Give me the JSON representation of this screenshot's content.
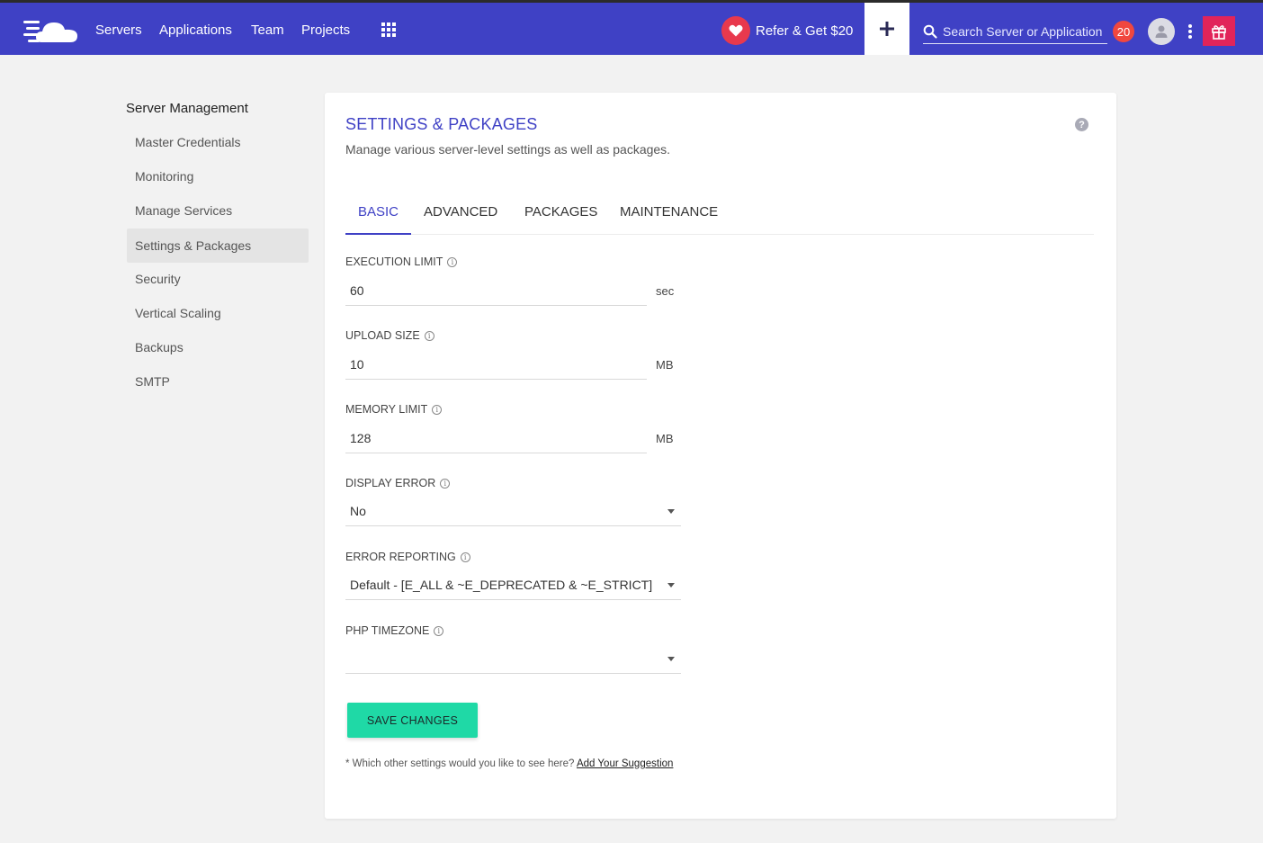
{
  "nav": {
    "links": [
      "Servers",
      "Applications",
      "Team",
      "Projects"
    ],
    "refer_label": "Refer & Get $20",
    "search_placeholder": "Search Server or Application",
    "notification_count": "20"
  },
  "sidebar": {
    "title": "Server Management",
    "items": [
      "Master Credentials",
      "Monitoring",
      "Manage Services",
      "Settings & Packages",
      "Security",
      "Vertical Scaling",
      "Backups",
      "SMTP"
    ],
    "active_item": "Settings & Packages"
  },
  "card": {
    "title": "SETTINGS & PACKAGES",
    "subtitle": "Manage various server-level settings as well as packages.",
    "help_glyph": "?",
    "tabs": [
      "BASIC",
      "ADVANCED",
      "PACKAGES",
      "MAINTENANCE"
    ],
    "active_tab": "BASIC"
  },
  "fields": {
    "execution_limit": {
      "label": "EXECUTION LIMIT",
      "value": "60",
      "unit": "sec"
    },
    "upload_size": {
      "label": "UPLOAD SIZE",
      "value": "10",
      "unit": "MB"
    },
    "memory_limit": {
      "label": "MEMORY LIMIT",
      "value": "128",
      "unit": "MB"
    },
    "display_error": {
      "label": "DISPLAY ERROR",
      "value": "No"
    },
    "error_reporting": {
      "label": "ERROR REPORTING",
      "value": "Default - [E_ALL & ~E_DEPRECATED & ~E_STRICT]"
    },
    "php_timezone": {
      "label": "PHP TIMEZONE",
      "value": ""
    }
  },
  "actions": {
    "save_label": "SAVE CHANGES",
    "footnote_text": "* Which other settings would you like to see here?",
    "footnote_link": "Add Your Suggestion"
  },
  "colors": {
    "brand": "#3f41c5",
    "save_button": "#1fd9a6",
    "badge": "#f0473f",
    "gift": "#e1245a",
    "heart": "#e8394d"
  },
  "icons": [
    "cloud-logo-icon",
    "apps-grid-icon",
    "heart-icon",
    "plus-icon",
    "search-icon",
    "user-avatar-icon",
    "more-vertical-icon",
    "gift-icon",
    "help-icon",
    "info-icon",
    "caret-down-icon"
  ]
}
